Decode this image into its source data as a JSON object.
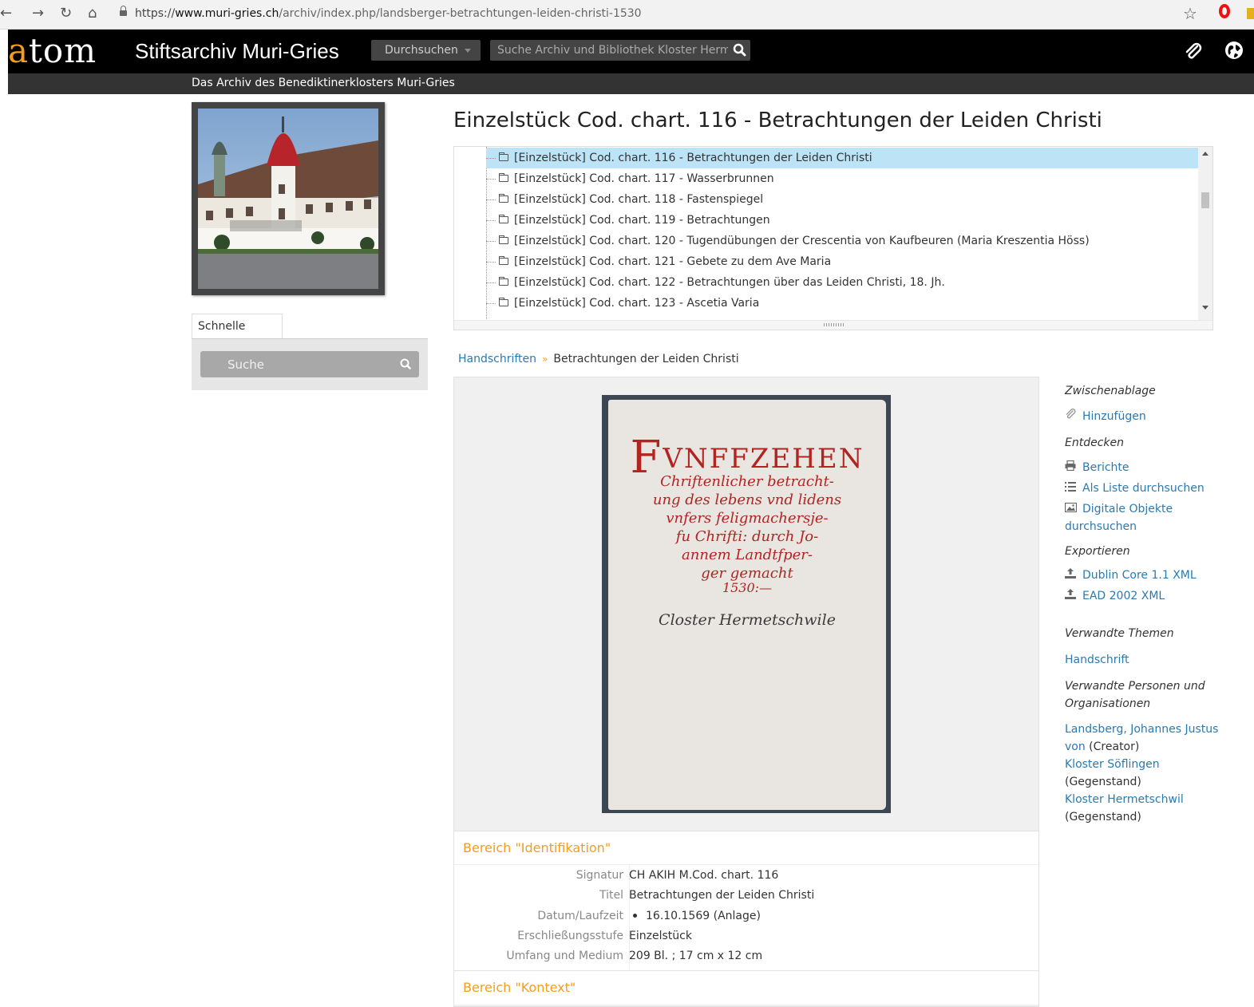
{
  "browser": {
    "url_scheme": "https://",
    "url_host": "www.muri-gries.ch",
    "url_path": "/archiv/index.php/landsberger-betrachtungen-leiden-christi-1530"
  },
  "header": {
    "logo_a": "a",
    "logo_rest": "tom",
    "site_title": "Stiftsarchiv Muri-Gries",
    "browse_label": "Durchsuchen",
    "search_placeholder": "Suche Archiv und Bibliothek Kloster Hermetschwil",
    "tagline": "Das Archiv des Benediktinerklosters Muri-Gries"
  },
  "sidebar": {
    "quick_search_tab": "Schnelle Suche",
    "quick_search_placeholder": "Suche"
  },
  "page": {
    "title": "Einzelstück Cod. chart. 116 - Betrachtungen der Leiden Christi"
  },
  "tree": {
    "items": [
      "[Einzelstück] Cod. chart. 116 - Betrachtungen der Leiden Christi",
      "[Einzelstück] Cod. chart. 117 - Wasserbrunnen",
      "[Einzelstück] Cod. chart. 118 - Fastenspiegel",
      "[Einzelstück] Cod. chart. 119 - Betrachtungen",
      "[Einzelstück] Cod. chart. 120 - Tugendübungen der Crescentia von Kaufbeuren (Maria Kreszentia Höss)",
      "[Einzelstück] Cod. chart. 121 - Gebete zu dem Ave Maria",
      "[Einzelstück] Cod. chart. 122 - Betrachtungen über das Leiden Christi, 18. Jh.",
      "[Einzelstück] Cod. chart. 123 - Ascetia Varia"
    ]
  },
  "breadcrumb": {
    "parent": "Handschriften",
    "separator": "»",
    "current": "Betrachtungen der Leiden Christi"
  },
  "cover": {
    "first_letter": "F",
    "heading": "VNFFZEHEN",
    "lines": [
      "Chriftenlicher betracht-",
      "ung des lebens vnd lidens",
      "vnfers feligmachersje-",
      "fu Chrifti: durch Jo-",
      "annem Landtfper-",
      "ger gemacht",
      "1530:—"
    ],
    "signature": "Closter Hermetschwile"
  },
  "identification": {
    "heading": "Bereich \"Identifikation\"",
    "fields": [
      {
        "label": "Signatur",
        "value": "CH AKIH M.Cod. chart. 116"
      },
      {
        "label": "Titel",
        "value": "Betrachtungen der Leiden Christi"
      },
      {
        "label": "Datum/Laufzeit",
        "value": "16.10.1569 (Anlage)"
      },
      {
        "label": "Erschließungsstufe",
        "value": "Einzelstück"
      },
      {
        "label": "Umfang und Medium",
        "value": "209 Bl. ; 17 cm x 12 cm"
      }
    ]
  },
  "context": {
    "heading": "Bereich \"Kontext\""
  },
  "right_column": {
    "clipboard_heading": "Zwischenablage",
    "clipboard_add": "Hinzufügen",
    "discover_heading": "Entdecken",
    "reports": "Berichte",
    "browse_list": "Als Liste durchsuchen",
    "browse_digital_1": "Digitale Objekte",
    "browse_digital_2": "durchsuchen",
    "export_heading": "Exportieren",
    "export_dc": "Dublin Core 1.1 XML",
    "export_ead": "EAD 2002 XML",
    "related_subjects_heading": "Verwandte Themen",
    "subject_1": "Handschrift",
    "related_actors_heading_1": "Verwandte Personen und",
    "related_actors_heading_2": "Organisationen",
    "actor_1_name_1": "Landsberg, Johannes Justus",
    "actor_1_name_2": "von",
    "actor_1_role": " (Creator)",
    "actor_2_name": "Kloster Söflingen",
    "actor_2_role": "(Gegenstand)",
    "actor_3_name": "Kloster Hermetschwil",
    "actor_3_role": "(Gegenstand)"
  }
}
